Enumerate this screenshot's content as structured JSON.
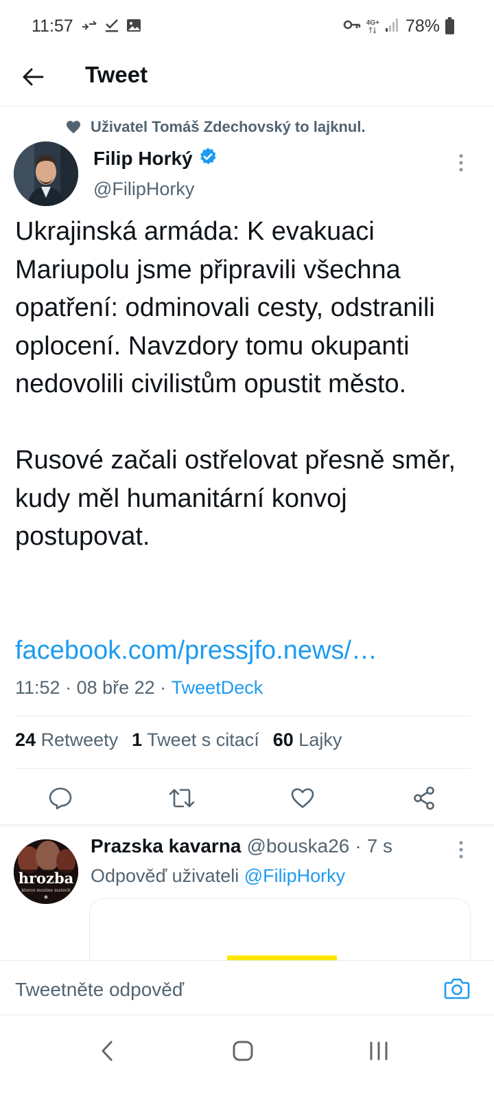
{
  "status_bar": {
    "time": "11:57",
    "network_label_top": "4G+",
    "battery": "78%",
    "icons": [
      "call-forwarding-icon",
      "checkmark-icon",
      "image-icon",
      "key-icon",
      "signal-icon",
      "battery-icon"
    ]
  },
  "header": {
    "title": "Tweet",
    "back_icon": "arrow-left-icon"
  },
  "tweet": {
    "social_context": "Uživatel Tomáš Zdechovský to lajknul.",
    "author": {
      "name": "Filip Horký",
      "handle": "@FilipHorky",
      "verified": true
    },
    "text_paragraphs": [
      "Ukrajinská armáda: K evakuaci Mariupolu jsme připravili všechna opatření: odminovali cesty, odstranili oplocení. Navzdory tomu okupanti nedovolili civilistům opustit město.",
      "Rusové začali ostřelovat přesně směr, kudy měl humanitární konvoj postupovat."
    ],
    "link": "facebook.com/pressjfo.news/…",
    "meta": {
      "time": "11:52",
      "separator": " · ",
      "date": "08 bře 22",
      "source": "TweetDeck"
    },
    "stats": {
      "retweets_count": "24",
      "retweets_label": "Retweety",
      "quotes_count": "1",
      "quotes_label": "Tweet s citací",
      "likes_count": "60",
      "likes_label": "Lajky"
    }
  },
  "reply": {
    "name": "Prazska kavarna",
    "handle": "@bouska26",
    "separator": "·",
    "time": "7 s",
    "reply_to_prefix": "Odpověď uživateli",
    "reply_to_handle": "@FilipHorky",
    "avatar_text": "hrozba",
    "avatar_subtext": "kterou musíme zastavit"
  },
  "composer": {
    "placeholder": "Tweetněte odpověď"
  },
  "colors": {
    "accent": "#1d9bf0",
    "secondary_text": "#536471",
    "primary_text": "#0f1419",
    "divider": "#e6ecf0"
  }
}
